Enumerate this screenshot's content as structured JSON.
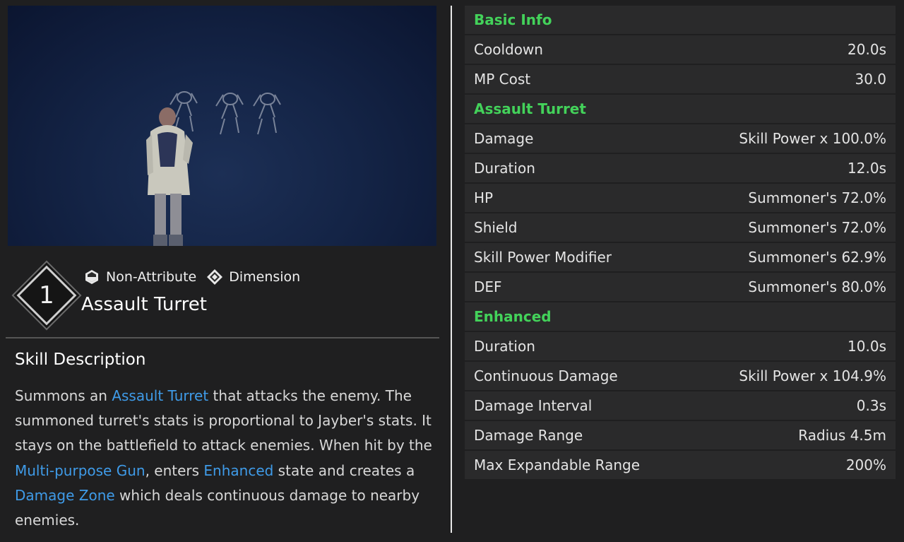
{
  "skill": {
    "number": "1",
    "attribute_tag": "Non-Attribute",
    "type_tag": "Dimension",
    "name": "Assault Turret"
  },
  "description": {
    "title": "Skill Description",
    "segments": [
      {
        "text": "Summons an ",
        "highlight": false
      },
      {
        "text": "Assault Turret",
        "highlight": true
      },
      {
        "text": " that attacks the enemy. The summoned turret's stats is proportional to Jayber's stats. It stays on the battlefield to attack enemies. When hit by the ",
        "highlight": false
      },
      {
        "text": "Multi-purpose Gun",
        "highlight": true
      },
      {
        "text": ", enters ",
        "highlight": false
      },
      {
        "text": "Enhanced",
        "highlight": true
      },
      {
        "text": " state and creates a ",
        "highlight": false
      },
      {
        "text": "Damage Zone",
        "highlight": true
      },
      {
        "text": " which deals continuous damage to nearby enemies.",
        "highlight": false
      }
    ]
  },
  "stats": [
    {
      "section": "Basic Info"
    },
    {
      "label": "Cooldown",
      "value": "20.0s"
    },
    {
      "label": "MP Cost",
      "value": "30.0"
    },
    {
      "section": "Assault Turret"
    },
    {
      "label": "Damage",
      "value": "Skill Power x 100.0%"
    },
    {
      "label": "Duration",
      "value": "12.0s"
    },
    {
      "label": "HP",
      "value": "Summoner's 72.0%"
    },
    {
      "label": "Shield",
      "value": "Summoner's 72.0%"
    },
    {
      "label": "Skill Power Modifier",
      "value": "Summoner's 62.9%"
    },
    {
      "label": "DEF",
      "value": "Summoner's 80.0%"
    },
    {
      "section": "Enhanced"
    },
    {
      "label": "Duration",
      "value": "10.0s"
    },
    {
      "label": "Continuous Damage",
      "value": "Skill Power x 104.9%"
    },
    {
      "label": "Damage Interval",
      "value": "0.3s"
    },
    {
      "label": "Damage Range",
      "value": "Radius 4.5m"
    },
    {
      "label": "Max Expandable Range",
      "value": "200%"
    }
  ],
  "colors": {
    "section_green": "#43d25a",
    "highlight_blue": "#3f9be8",
    "row_bg": "#2a2a2b",
    "page_bg": "#1f1f20"
  }
}
